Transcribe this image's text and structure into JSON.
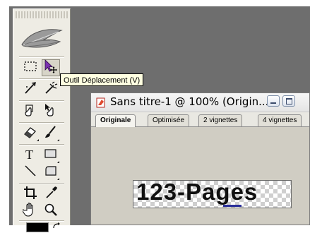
{
  "toolbox": {
    "tools": [
      {
        "name": "marquee-tool-icon"
      },
      {
        "name": "move-tool-icon"
      },
      {
        "name": "lasso-tool-icon"
      },
      {
        "name": "magic-wand-tool-icon"
      },
      {
        "name": "crop-tool-icon"
      },
      {
        "name": "slice-select-tool-icon"
      },
      {
        "name": "eraser-tool-icon"
      },
      {
        "name": "brush-tool-icon"
      },
      {
        "name": "type-tool-icon"
      },
      {
        "name": "rectangle-tool-icon"
      },
      {
        "name": "line-tool-icon"
      },
      {
        "name": "shape-tool-icon"
      },
      {
        "name": "crop-tool-2-icon"
      },
      {
        "name": "eyedropper-tool-icon"
      },
      {
        "name": "hand-tool-icon"
      },
      {
        "name": "zoom-tool-icon"
      }
    ],
    "tooltip": "Outil Déplacement (V)",
    "colors": {
      "foreground": "#000000",
      "background": "#ffffff"
    }
  },
  "document": {
    "title": "Sans titre-1 @ 100% (Origin...",
    "tabs": [
      {
        "label": "Originale",
        "active": true
      },
      {
        "label": "Optimisée",
        "active": false
      },
      {
        "label": "2 vignettes",
        "active": false
      },
      {
        "label": "4 vignettes",
        "active": false
      }
    ],
    "canvas_text": "123-Pages"
  }
}
